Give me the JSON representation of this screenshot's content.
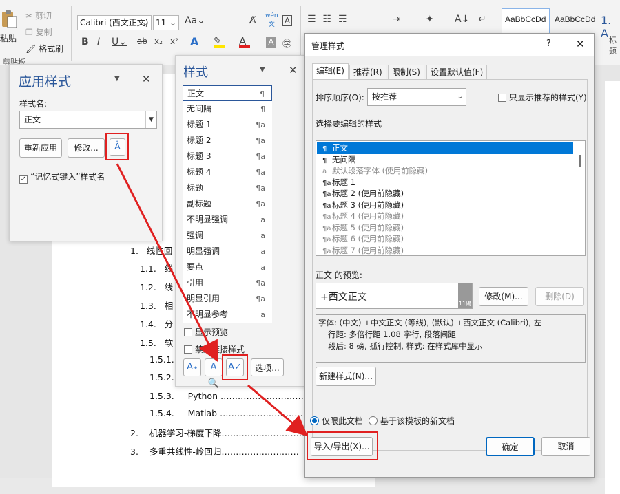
{
  "ribbon": {
    "paste_label": "粘贴",
    "cut_label": "剪切",
    "copy_label": "复制",
    "format_painter_label": "格式刷",
    "clipboard_group": "剪贴板",
    "font_name": "Calibri (西文正文)",
    "font_size": "11",
    "grow_font": "Aa",
    "phonetic": "wén",
    "style_gallery": [
      "AaBbCcDd",
      "AaBbCcDd",
      "1. A"
    ],
    "style_gallery_caption": "标题"
  },
  "apply_styles": {
    "title": "应用样式",
    "style_name_label": "样式名:",
    "style_name_value": "正文",
    "reapply_label": "重新应用",
    "modify_label": "修改...",
    "autocomplete_label": "“记忆式键入”样式名"
  },
  "styles_pane": {
    "title": "样式",
    "items": [
      {
        "name": "正文",
        "mark": "¶"
      },
      {
        "name": "无间隔",
        "mark": "¶"
      },
      {
        "name": "标题 1",
        "mark": "¶a"
      },
      {
        "name": "标题 2",
        "mark": "¶a"
      },
      {
        "name": "标题 3",
        "mark": "¶a"
      },
      {
        "name": "标题 4",
        "mark": "¶a"
      },
      {
        "name": "标题",
        "mark": "¶a"
      },
      {
        "name": "副标题",
        "mark": "¶a"
      },
      {
        "name": "不明显强调",
        "mark": "a"
      },
      {
        "name": "强调",
        "mark": "a"
      },
      {
        "name": "明显强调",
        "mark": "a"
      },
      {
        "name": "要点",
        "mark": "a"
      },
      {
        "name": "引用",
        "mark": "¶a"
      },
      {
        "name": "明显引用",
        "mark": "¶a"
      },
      {
        "name": "不明显参考",
        "mark": "a"
      }
    ],
    "show_preview_label": "显示预览",
    "disable_linked_label": "禁用链接样式",
    "options_label": "选项..."
  },
  "document": {
    "toc": [
      {
        "num": "1.",
        "text": "线性回"
      },
      {
        "num": "1.1.",
        "text": "线"
      },
      {
        "num": "1.2.",
        "text": "线"
      },
      {
        "num": "1.3.",
        "text": "相"
      },
      {
        "num": "1.4.",
        "text": "分"
      },
      {
        "num": "1.5.",
        "text": "软"
      },
      {
        "num": "1.5.1.",
        "text": ""
      },
      {
        "num": "1.5.2.",
        "text": ""
      },
      {
        "num": "1.5.3.",
        "text": "Python ……………………………………"
      },
      {
        "num": "1.5.4.",
        "text": "Matlab ……………………………………"
      },
      {
        "num": "2.",
        "text": "机器学习-梯度下降……………………………"
      },
      {
        "num": "3.",
        "text": "多重共线性-岭回归………………………"
      }
    ]
  },
  "manage_dialog": {
    "title": "管理样式",
    "help": "?",
    "tabs": [
      "编辑(E)",
      "推荐(R)",
      "限制(S)",
      "设置默认值(F)"
    ],
    "sort_label": "排序顺序(O):",
    "sort_value": "按推荐",
    "only_recommended_label": "只显示推荐的样式(Y)",
    "select_label": "选择要编辑的样式",
    "style_list": [
      {
        "icon": "¶",
        "name": "正文",
        "gray": false
      },
      {
        "icon": "¶",
        "name": "无间隔",
        "gray": false
      },
      {
        "icon": "a",
        "name": "默认段落字体 (使用前隐藏)",
        "gray": true
      },
      {
        "icon": "¶a",
        "name": "标题 1",
        "gray": false
      },
      {
        "icon": "¶a",
        "name": "标题 2 (使用前隐藏)",
        "gray": false
      },
      {
        "icon": "¶a",
        "name": "标题 3 (使用前隐藏)",
        "gray": false
      },
      {
        "icon": "¶a",
        "name": "标题 4 (使用前隐藏)",
        "gray": true
      },
      {
        "icon": "¶a",
        "name": "标题 5 (使用前隐藏)",
        "gray": true
      },
      {
        "icon": "¶a",
        "name": "标题 6 (使用前隐藏)",
        "gray": true
      },
      {
        "icon": "¶a",
        "name": "标题 7 (使用前隐藏)",
        "gray": true
      }
    ],
    "preview_label": "正文 的预览:",
    "preview_text": "+西文正文",
    "preview_size": "11磅",
    "modify_label": "修改(M)...",
    "delete_label": "删除(D)",
    "description_lines": [
      "字体: (中文) +中文正文 (等线), (默认) +西文正文 (Calibri), 左",
      "行距: 多倍行距 1.08 字行, 段落间距",
      "段后: 8 磅, 孤行控制, 样式: 在样式库中显示"
    ],
    "new_style_label": "新建样式(N)...",
    "radio_doc_label": "仅限此文档",
    "radio_template_label": "基于该模板的新文档",
    "import_export_label": "导入/导出(X)...",
    "ok_label": "确定",
    "cancel_label": "取消"
  },
  "colors": {
    "accent": "#0078d7",
    "highlight": "#e02020",
    "selected": "#0078d7"
  }
}
